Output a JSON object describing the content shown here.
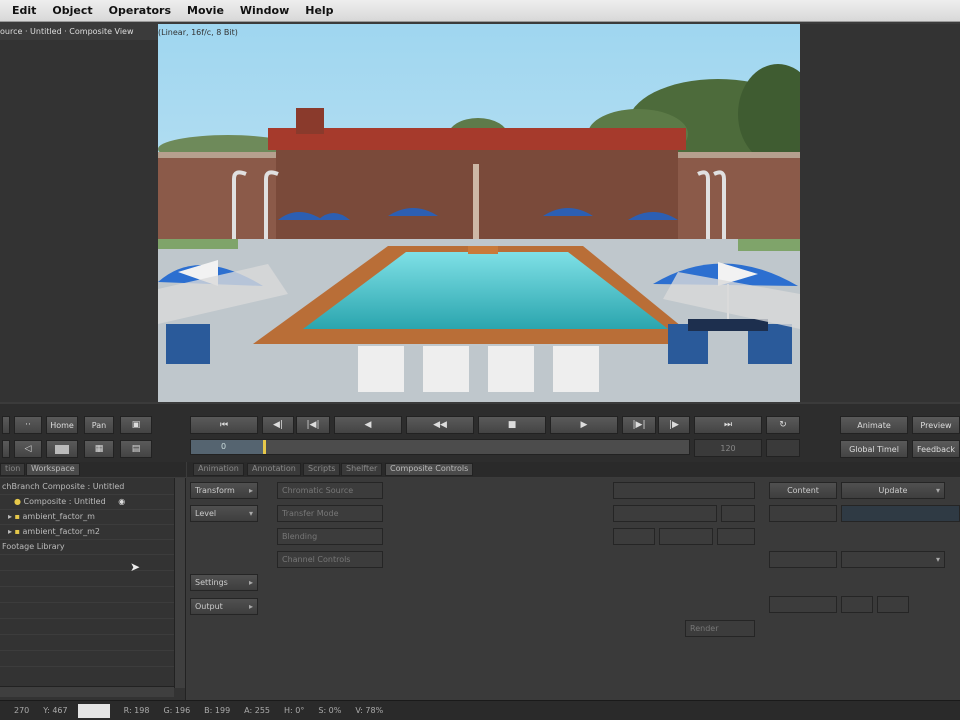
{
  "menu": [
    "Edit",
    "Object",
    "Operators",
    "Movie",
    "Window",
    "Help"
  ],
  "viewer": {
    "title": "ource · Untitled · Composite View",
    "info": "(Linear, 16f/c, 8 Bit)"
  },
  "transport": {
    "left_buttons": [
      "",
      "Home",
      "Pan"
    ],
    "frame_start": "0",
    "frame_end": "120",
    "right_top": [
      "Animate",
      "Preview"
    ],
    "right_bottom": [
      "Global Timel",
      "Feedback"
    ]
  },
  "tabs": {
    "left": [
      "tion",
      "Workspace"
    ],
    "main": [
      "Animation",
      "Annotation",
      "Scripts",
      "Shelfter",
      "Composite Controls"
    ]
  },
  "tree": {
    "rows": [
      "chBranch Composite : Untitled",
      "Composite : Untitled",
      "ambient_factor_m",
      "ambient_factor_m2",
      "Footage Library"
    ]
  },
  "controls": {
    "col1": [
      "Transform",
      "Level",
      "Settings",
      "Output"
    ],
    "col2": [
      "Chromatic Source",
      "Transfer Mode",
      "Blending",
      "Channel Controls"
    ],
    "right_top": [
      "Content",
      "Update"
    ],
    "render": "Render"
  },
  "status": {
    "x": "270",
    "y": "Y: 467",
    "r": "R: 198",
    "g": "G: 196",
    "b": "B: 199",
    "a": "A: 255",
    "h": "H: 0°",
    "s": "S: 0%",
    "v": "V: 78%"
  },
  "colors": {
    "accent": "#e6c84a",
    "panel": "#3a3a3a",
    "sky": "#a9d8ee"
  }
}
